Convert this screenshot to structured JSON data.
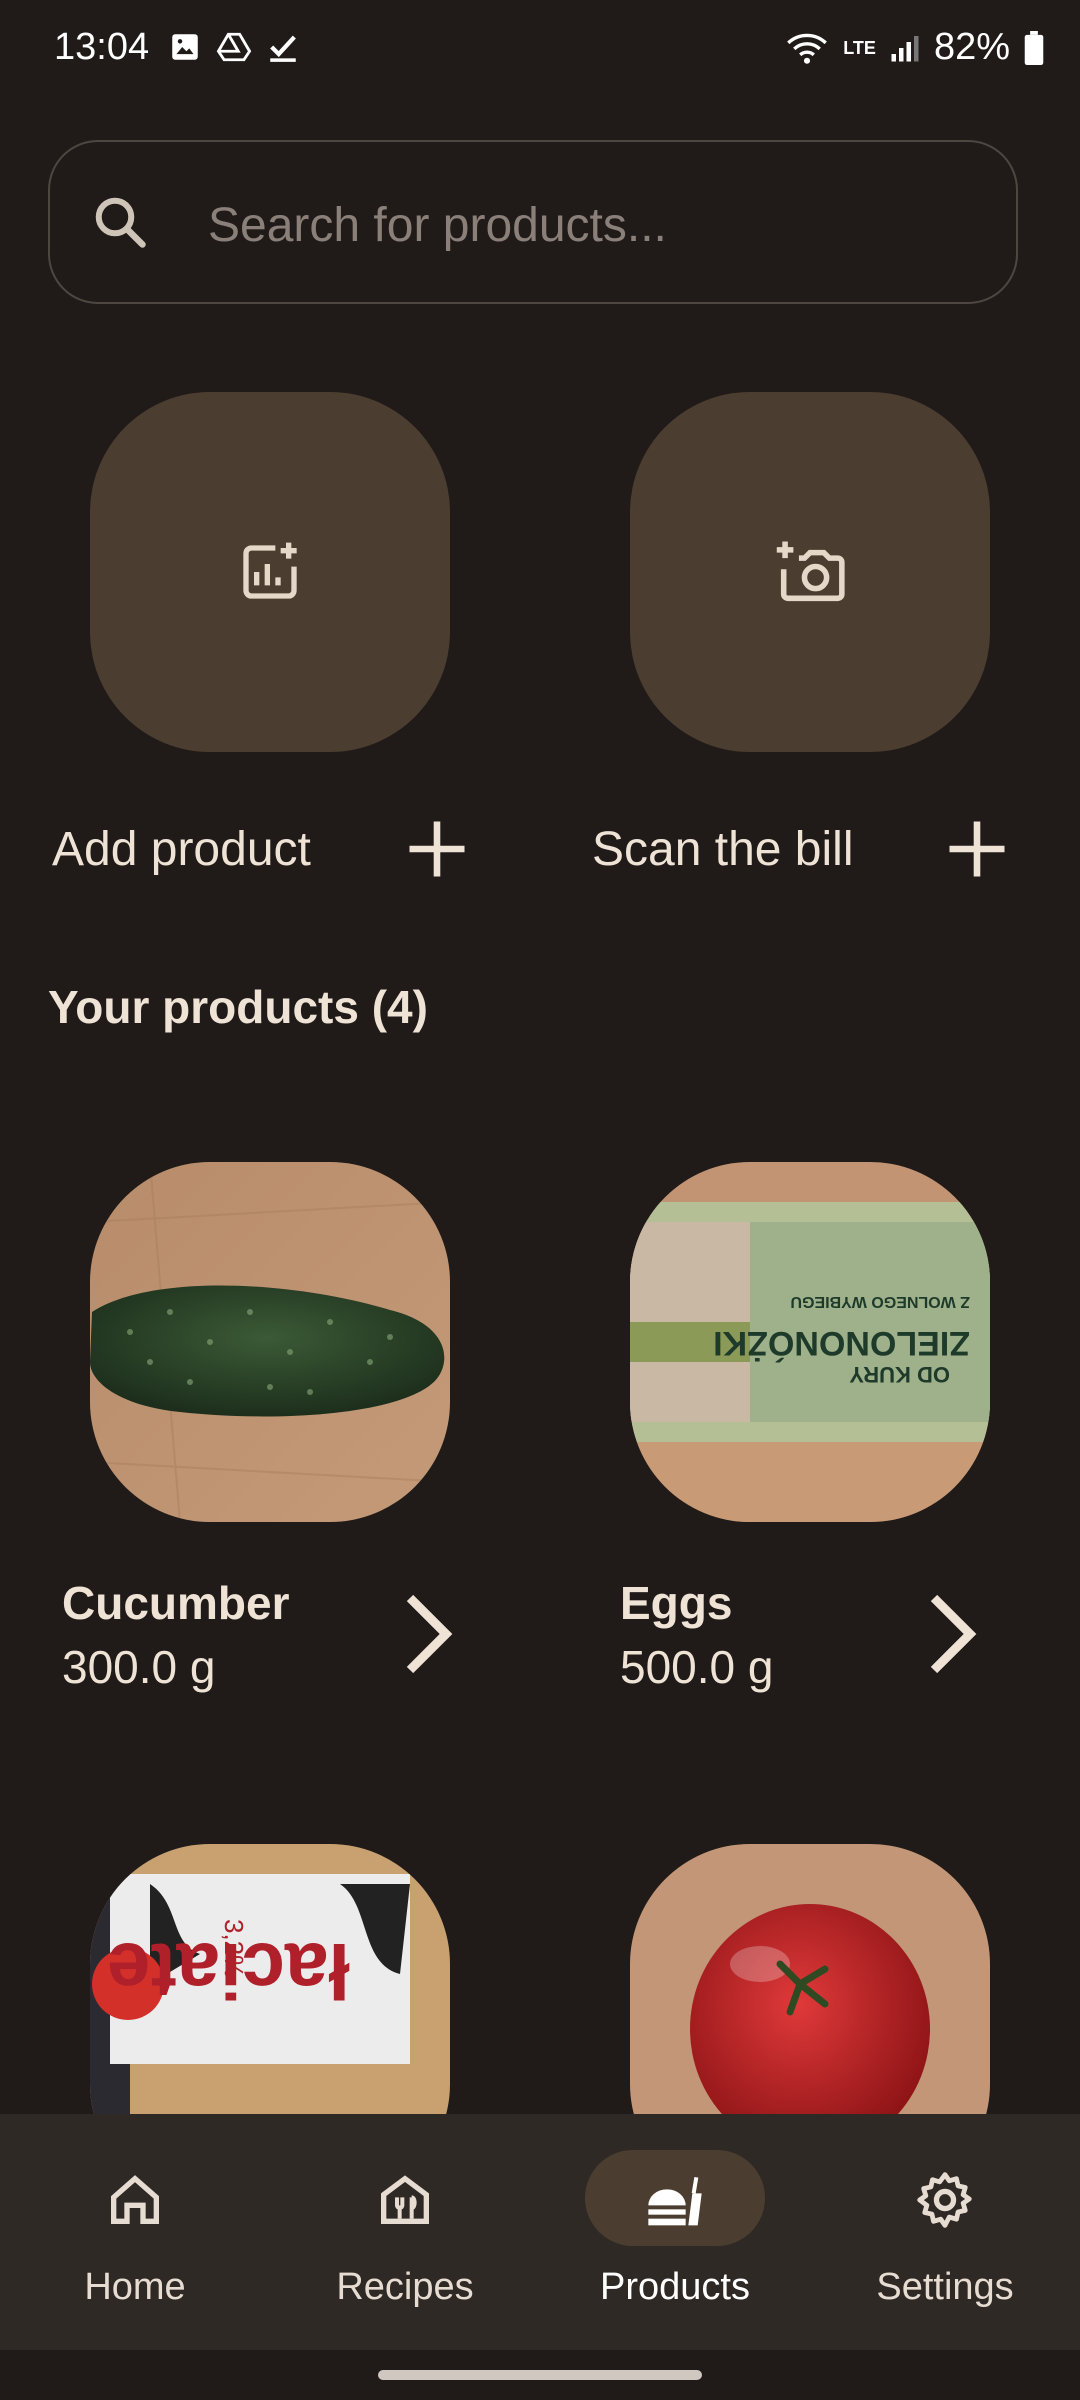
{
  "status_bar": {
    "time": "13:04",
    "battery": "82%",
    "network": "LTE"
  },
  "search": {
    "placeholder": "Search for products..."
  },
  "actions": [
    {
      "label": "Add product",
      "icon": "add-chart-icon"
    },
    {
      "label": "Scan the bill",
      "icon": "add-camera-icon"
    }
  ],
  "section_title": "Your products (4)",
  "products": [
    {
      "name": "Cucumber",
      "quantity": "300.0 g"
    },
    {
      "name": "Eggs",
      "quantity": "500.0 g"
    },
    {
      "name": "",
      "quantity": ""
    },
    {
      "name": "",
      "quantity": ""
    }
  ],
  "nav": {
    "items": [
      {
        "label": "Home",
        "icon": "home-icon"
      },
      {
        "label": "Recipes",
        "icon": "recipes-icon"
      },
      {
        "label": "Products",
        "icon": "products-icon"
      },
      {
        "label": "Settings",
        "icon": "gear-icon"
      }
    ],
    "active": "Products"
  },
  "colors": {
    "background": "#201b19",
    "tile": "#4b3e30",
    "nav": "#2f2925",
    "text": "#efe3d6"
  }
}
